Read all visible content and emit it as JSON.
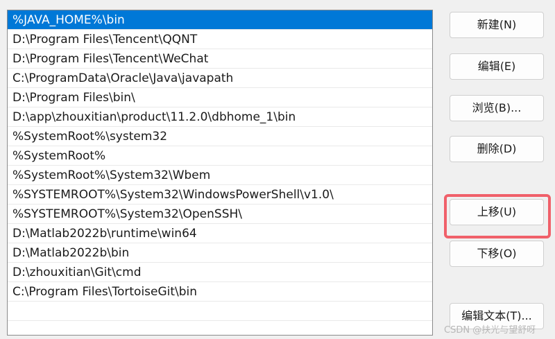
{
  "paths": [
    "%JAVA_HOME%\\bin",
    "D:\\Program Files\\Tencent\\QQNT",
    "D:\\Program Files\\Tencent\\WeChat",
    "C:\\ProgramData\\Oracle\\Java\\javapath",
    "D:\\Program Files\\bin\\",
    "D:\\app\\zhouxitian\\product\\11.2.0\\dbhome_1\\bin",
    "%SystemRoot%\\system32",
    "%SystemRoot%",
    "%SystemRoot%\\System32\\Wbem",
    "%SYSTEMROOT%\\System32\\WindowsPowerShell\\v1.0\\",
    "%SYSTEMROOT%\\System32\\OpenSSH\\",
    "D:\\Matlab2022b\\runtime\\win64",
    "D:\\Matlab2022b\\bin",
    "D:\\zhouxitian\\Git\\cmd",
    "C:\\Program Files\\TortoiseGit\\bin"
  ],
  "buttons": {
    "new": "新建(N)",
    "edit": "编辑(E)",
    "browse": "浏览(B)...",
    "delete": "删除(D)",
    "move_up": "上移(U)",
    "move_down": "下移(O)",
    "edit_text": "编辑文本(T)..."
  },
  "watermark": "CSDN @扶光与望舒呀",
  "colors": {
    "selection": "#0078d7",
    "highlight": "#f0606a"
  }
}
